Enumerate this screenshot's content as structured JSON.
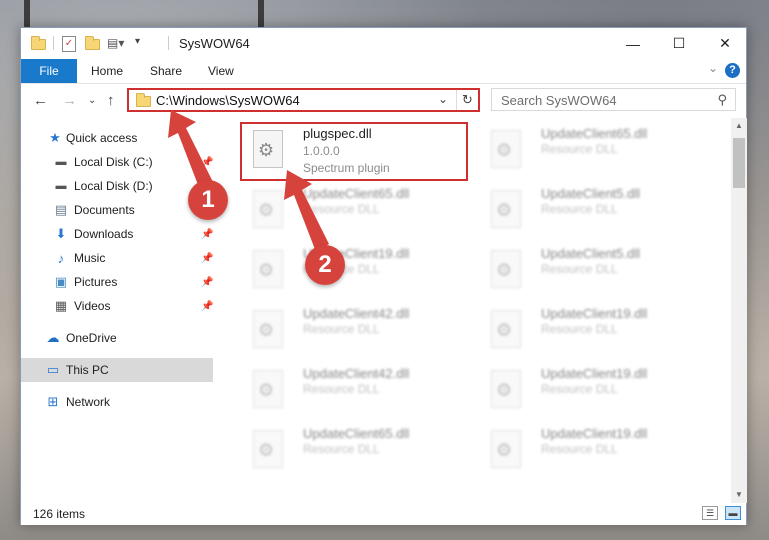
{
  "window": {
    "title": "SysWOW64"
  },
  "titlebar": {
    "minimize": "—",
    "maximize": "☐",
    "close": "✕"
  },
  "ribbon": {
    "tabs": [
      "File",
      "Home",
      "Share",
      "View"
    ],
    "help": "?"
  },
  "address": {
    "path": "C:\\Windows\\SysWOW64",
    "search_placeholder": "Search SysWOW64"
  },
  "nav": {
    "items": [
      {
        "label": "Quick access",
        "icon": "star-icon"
      },
      {
        "label": "Local Disk (C:)",
        "icon": "drive-icon",
        "pinned": true
      },
      {
        "label": "Local Disk (D:)",
        "icon": "drive-icon"
      },
      {
        "label": "Documents",
        "icon": "document-icon"
      },
      {
        "label": "Downloads",
        "icon": "download-icon",
        "pinned": true
      },
      {
        "label": "Music",
        "icon": "music-icon",
        "pinned": true
      },
      {
        "label": "Pictures",
        "icon": "pictures-icon",
        "pinned": true
      },
      {
        "label": "Videos",
        "icon": "videos-icon",
        "pinned": true
      },
      {
        "label": "OneDrive",
        "icon": "cloud-icon"
      },
      {
        "label": "This PC",
        "icon": "computer-icon",
        "selected": true
      },
      {
        "label": "Network",
        "icon": "network-icon"
      }
    ]
  },
  "files": {
    "highlighted": {
      "name": "plugspec.dll",
      "version": "1.0.0.0",
      "description": "Spectrum plugin"
    },
    "left_column": [
      {
        "name": "UpdateClient65.dll",
        "description": "Resource DLL"
      },
      {
        "name": "UpdateClient19.dll",
        "description": "Resource DLL"
      },
      {
        "name": "UpdateClient42.dll",
        "description": "Resource DLL"
      },
      {
        "name": "UpdateClient42.dll",
        "description": "Resource DLL"
      },
      {
        "name": "UpdateClient65.dll",
        "description": "Resource DLL"
      }
    ],
    "right_column": [
      {
        "name": "UpdateClient65.dll",
        "description": "Resource DLL"
      },
      {
        "name": "UpdateClient5.dll",
        "description": "Resource DLL"
      },
      {
        "name": "UpdateClient5.dll",
        "description": "Resource DLL"
      },
      {
        "name": "UpdateClient19.dll",
        "description": "Resource DLL"
      },
      {
        "name": "UpdateClient19.dll",
        "description": "Resource DLL"
      },
      {
        "name": "UpdateClient19.dll",
        "description": "Resource DLL"
      }
    ]
  },
  "status": {
    "item_count": "126 items"
  },
  "annotations": {
    "step1": "1",
    "step2": "2",
    "color": "#d6433d"
  }
}
